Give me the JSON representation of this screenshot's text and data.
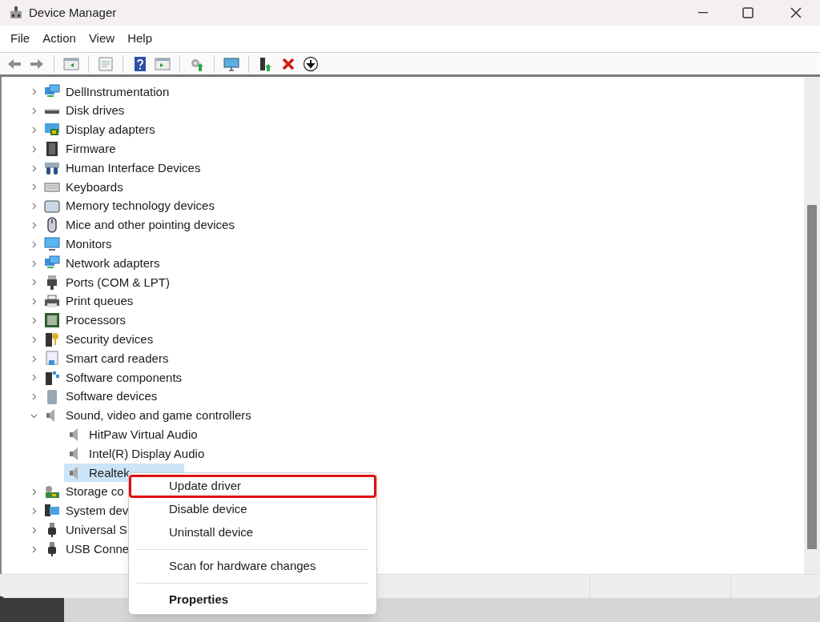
{
  "window": {
    "title": "Device Manager"
  },
  "menu_bar": [
    "File",
    "Action",
    "View",
    "Help"
  ],
  "tree": [
    {
      "label": "DellInstrumentation",
      "expanded": false
    },
    {
      "label": "Disk drives",
      "expanded": false
    },
    {
      "label": "Display adapters",
      "expanded": false
    },
    {
      "label": "Firmware",
      "expanded": false
    },
    {
      "label": "Human Interface Devices",
      "expanded": false
    },
    {
      "label": "Keyboards",
      "expanded": false
    },
    {
      "label": "Memory technology devices",
      "expanded": false
    },
    {
      "label": "Mice and other pointing devices",
      "expanded": false
    },
    {
      "label": "Monitors",
      "expanded": false
    },
    {
      "label": "Network adapters",
      "expanded": false
    },
    {
      "label": "Ports (COM & LPT)",
      "expanded": false
    },
    {
      "label": "Print queues",
      "expanded": false
    },
    {
      "label": "Processors",
      "expanded": false
    },
    {
      "label": "Security devices",
      "expanded": false
    },
    {
      "label": "Smart card readers",
      "expanded": false
    },
    {
      "label": "Software components",
      "expanded": false
    },
    {
      "label": "Software devices",
      "expanded": false
    },
    {
      "label": "Sound, video and game controllers",
      "expanded": true,
      "children": [
        {
          "label": "HitPaw Virtual Audio",
          "selected": false
        },
        {
          "label": "Intel(R) Display Audio",
          "selected": false
        },
        {
          "label": "Realtek",
          "selected": true
        }
      ]
    },
    {
      "label": "Storage co",
      "expanded": false
    },
    {
      "label": "System dev",
      "expanded": false
    },
    {
      "label": "Universal S",
      "expanded": false
    },
    {
      "label": "USB Conne",
      "expanded": false
    }
  ],
  "context_menu": [
    [
      {
        "label": "Update driver",
        "highlighted": true,
        "default": false
      },
      {
        "label": "Disable device",
        "highlighted": false,
        "default": false
      },
      {
        "label": "Uninstall device",
        "highlighted": false,
        "default": false
      }
    ],
    [
      {
        "label": "Scan for hardware changes",
        "highlighted": false,
        "default": false
      }
    ],
    [
      {
        "label": "Properties",
        "highlighted": false,
        "default": true
      }
    ]
  ]
}
